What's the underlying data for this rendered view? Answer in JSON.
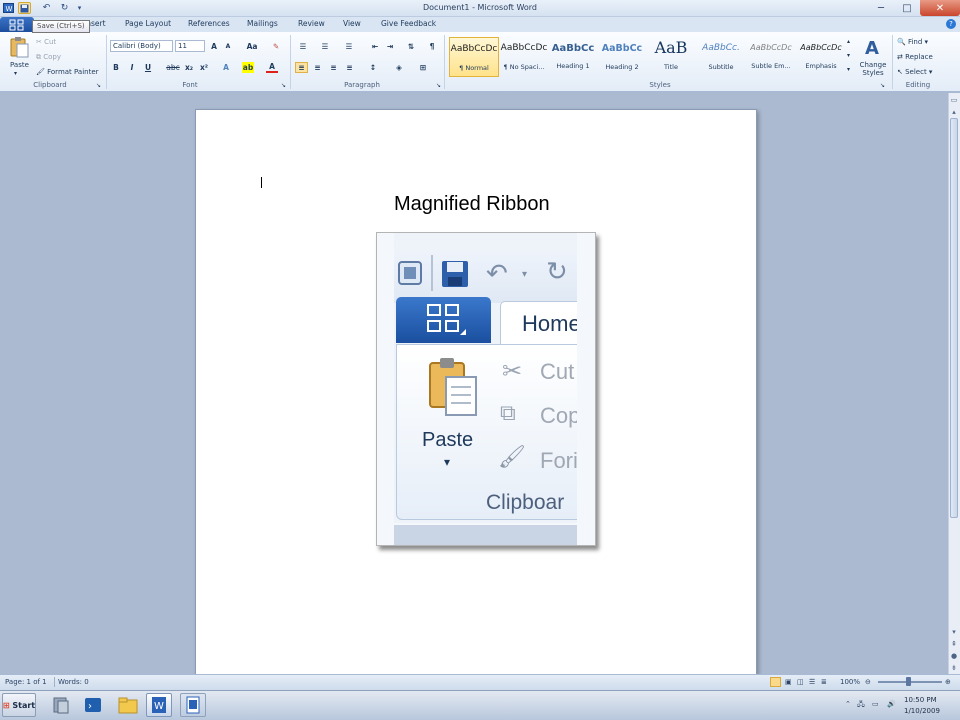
{
  "window": {
    "title": "Document1  -  Microsoft Word",
    "tooltip": "Save (Ctrl+S)"
  },
  "tabs": [
    "Insert",
    "Page Layout",
    "References",
    "Mailings",
    "Review",
    "View",
    "Give Feedback"
  ],
  "ribbon": {
    "clipboard": {
      "label": "Clipboard",
      "paste": "Paste",
      "cut": "Cut",
      "copy": "Copy",
      "format_painter": "Format Painter"
    },
    "font": {
      "label": "Font",
      "font_name": "Calibri (Body)",
      "font_size": "11"
    },
    "paragraph": {
      "label": "Paragraph"
    },
    "styles": {
      "label": "Styles",
      "items": [
        {
          "sample": "AaBbCcDc",
          "name": "¶ Normal"
        },
        {
          "sample": "AaBbCcDc",
          "name": "¶ No Spaci..."
        },
        {
          "sample": "AaBbCc",
          "name": "Heading 1"
        },
        {
          "sample": "AaBbCc",
          "name": "Heading 2"
        },
        {
          "sample": "AaB",
          "name": "Title"
        },
        {
          "sample": "AaBbCc.",
          "name": "Subtitle"
        },
        {
          "sample": "AaBbCcDc",
          "name": "Subtle Em..."
        },
        {
          "sample": "AaBbCcDc",
          "name": "Emphasis"
        }
      ],
      "change_styles": "Change Styles"
    },
    "editing": {
      "label": "Editing",
      "find": "Find",
      "replace": "Replace",
      "select": "Select"
    }
  },
  "annotation": {
    "caption": "Magnified Ribbon",
    "home_tab": "Home",
    "paste": "Paste",
    "cut": "Cut",
    "copy": "Cop",
    "format": "Fori",
    "group_label": "Clipboar"
  },
  "status": {
    "page": "Page: 1 of 1",
    "words": "Words: 0",
    "zoom": "100%",
    "zoom_level_pct": 100
  },
  "taskbar": {
    "start": "Start",
    "time": "10:50 PM",
    "date": "1/10/2009"
  },
  "colors": {
    "file_tab": "#2a62b8",
    "accent_style": "#ffe28a",
    "page_bg": "#ffffff",
    "workspace": "#abbad0"
  }
}
